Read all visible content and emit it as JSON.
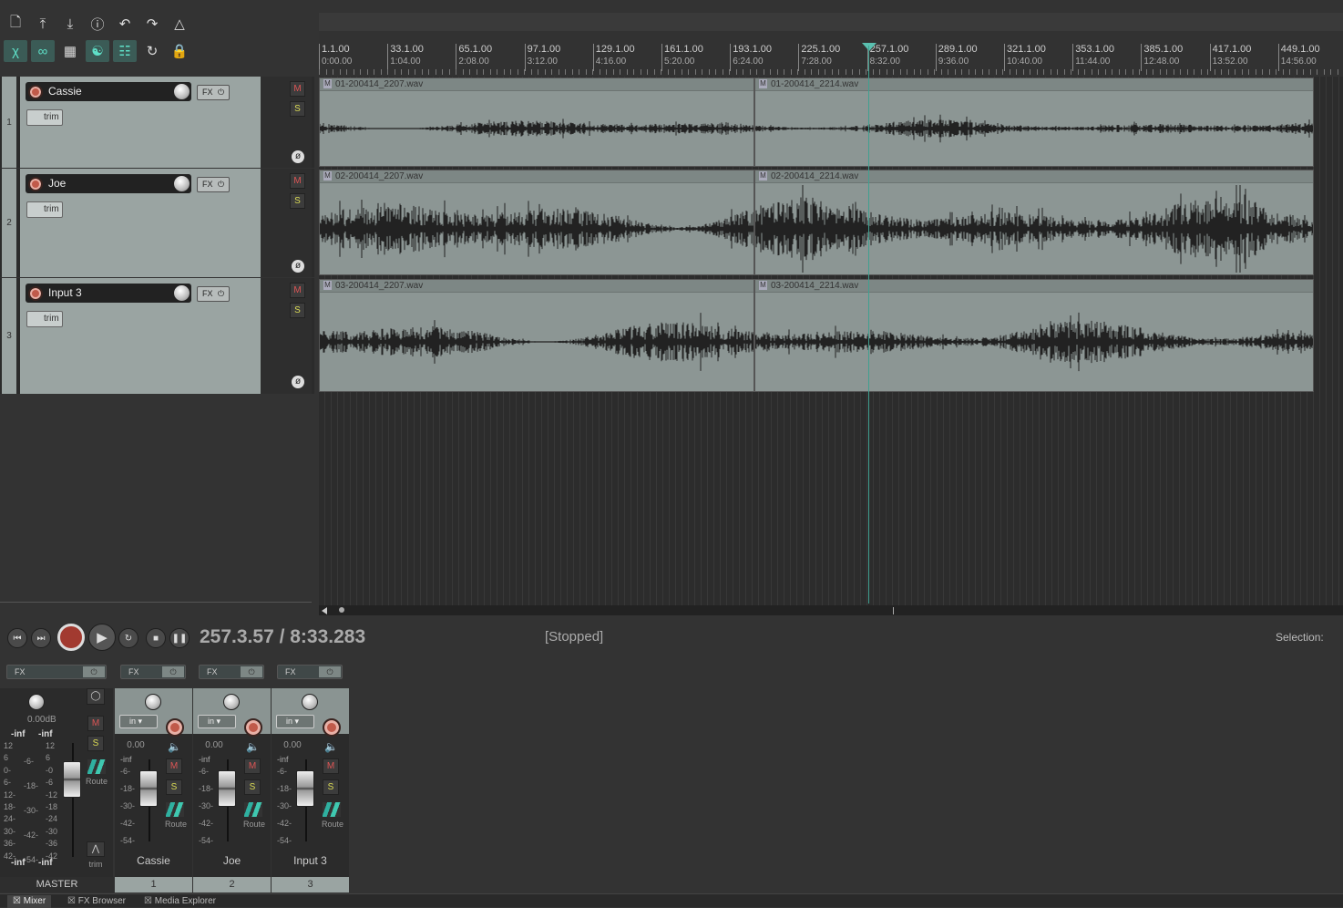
{
  "toolbar": {
    "row1": [
      "new-project-icon",
      "save-icon",
      "save-as-icon",
      "info-icon",
      "undo-icon",
      "redo-icon",
      "metronome-icon"
    ],
    "row2": [
      "ripple-edit-icon",
      "link-icon",
      "grid-icon",
      "snap-icon",
      "lock-grid-icon",
      "loop-icon",
      "lock-icon"
    ]
  },
  "ruler": [
    {
      "m": "1.1.00",
      "t": "0:00.00"
    },
    {
      "m": "33.1.00",
      "t": "1:04.00"
    },
    {
      "m": "65.1.00",
      "t": "2:08.00"
    },
    {
      "m": "97.1.00",
      "t": "3:12.00"
    },
    {
      "m": "129.1.00",
      "t": "4:16.00"
    },
    {
      "m": "161.1.00",
      "t": "5:20.00"
    },
    {
      "m": "193.1.00",
      "t": "6:24.00"
    },
    {
      "m": "225.1.00",
      "t": "7:28.00"
    },
    {
      "m": "257.1.00",
      "t": "8:32.00"
    },
    {
      "m": "289.1.00",
      "t": "9:36.00"
    },
    {
      "m": "321.1.00",
      "t": "10:40.00"
    },
    {
      "m": "353.1.00",
      "t": "11:44.00"
    },
    {
      "m": "385.1.00",
      "t": "12:48.00"
    },
    {
      "m": "417.1.00",
      "t": "13:52.00"
    },
    {
      "m": "449.1.00",
      "t": "14:56.00"
    }
  ],
  "tracks": [
    {
      "num": "1",
      "name": "Cassie",
      "fx": "FX",
      "trim": "trim",
      "mute": "M",
      "solo": "S",
      "items": [
        "01-200414_2207.wav",
        "01-200414_2214.wav"
      ]
    },
    {
      "num": "2",
      "name": "Joe",
      "fx": "FX",
      "trim": "trim",
      "mute": "M",
      "solo": "S",
      "items": [
        "02-200414_2207.wav",
        "02-200414_2214.wav"
      ]
    },
    {
      "num": "3",
      "name": "Input 3",
      "fx": "FX",
      "trim": "trim",
      "mute": "M",
      "solo": "S",
      "items": [
        "03-200414_2207.wav",
        "03-200414_2214.wav"
      ]
    }
  ],
  "transport": {
    "position": "257.3.57 / 8:33.283",
    "status": "[Stopped]",
    "selection": "Selection:"
  },
  "mixer": {
    "master": {
      "label": "MASTER",
      "fx": "FX",
      "db": "0.00dB",
      "peakL": "-inf",
      "peakR": "-inf",
      "bottomL": "-inf",
      "bottomR": "-inf",
      "mute": "M",
      "solo": "S",
      "route": "Route",
      "trim": "trim",
      "scaleL": [
        "12",
        "6",
        "0-",
        "6-",
        "12-",
        "18-",
        "24-",
        "30-",
        "36-",
        "42-"
      ],
      "scaleMid": [
        "-6-",
        "-18-",
        "-30-",
        "-42-",
        "-54-"
      ],
      "scaleR": [
        "12",
        "6",
        "-0",
        "-6",
        "-12",
        "-18",
        "-24",
        "-30",
        "-36",
        "-42"
      ]
    },
    "channels": [
      {
        "name": "Cassie",
        "num": "1",
        "fx": "FX",
        "in": "in",
        "db": "0.00",
        "peak": "-inf",
        "mute": "M",
        "solo": "S",
        "route": "Route"
      },
      {
        "name": "Joe",
        "num": "2",
        "fx": "FX",
        "in": "in",
        "db": "0.00",
        "peak": "-inf",
        "mute": "M",
        "solo": "S",
        "route": "Route"
      },
      {
        "name": "Input 3",
        "num": "3",
        "fx": "FX",
        "in": "in",
        "db": "0.00",
        "peak": "-inf",
        "mute": "M",
        "solo": "S",
        "route": "Route"
      }
    ],
    "chscale": [
      "-6-",
      "-18-",
      "-30-",
      "-42-",
      "-54-"
    ]
  },
  "tabs": [
    "Mixer",
    "FX Browser",
    "Media Explorer"
  ],
  "colors": {
    "accent": "#3fa090",
    "record": "#c05a4a",
    "item": "#8c9694"
  }
}
